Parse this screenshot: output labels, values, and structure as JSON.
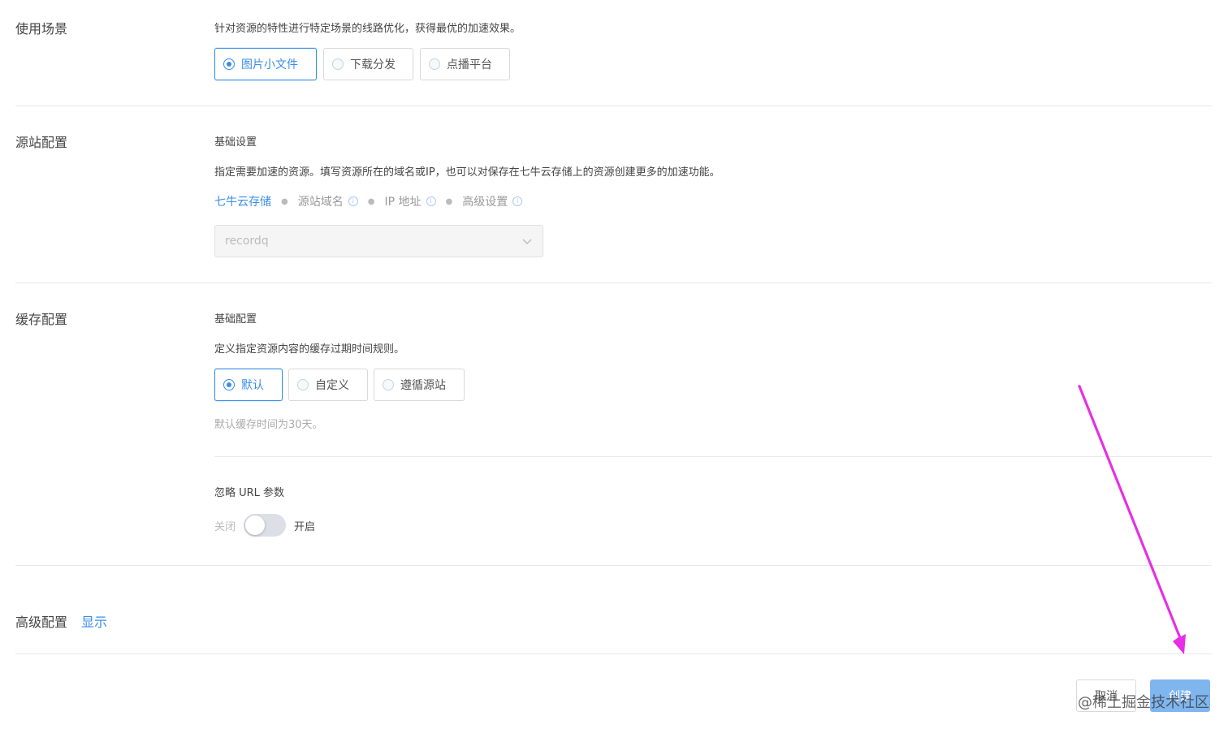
{
  "scenario": {
    "label": "使用场景",
    "description": "针对资源的特性进行特定场景的线路优化，获得最优的加速效果。",
    "options": [
      "图片小文件",
      "下载分发",
      "点播平台"
    ],
    "selected": "图片小文件"
  },
  "origin": {
    "label": "源站配置",
    "subtitle": "基础设置",
    "description": "指定需要加速的资源。填写资源所在的域名或IP，也可以对保存在七牛云存储上的资源创建更多的加速功能。",
    "tabs": [
      "七牛云存储",
      "源站域名",
      "IP 地址",
      "高级设置"
    ],
    "active_tab": "七牛云存储",
    "select_value": "recordq"
  },
  "cache": {
    "label": "缓存配置",
    "subtitle": "基础配置",
    "description": "定义指定资源内容的缓存过期时间规则。",
    "options": [
      "默认",
      "自定义",
      "遵循源站"
    ],
    "selected": "默认",
    "hint": "默认缓存时间为30天。",
    "ignore_url_title": "忽略 URL 参数",
    "switch_off_label": "关闭",
    "switch_on_label": "开启",
    "switch_on": false
  },
  "advanced": {
    "label": "高级配置",
    "toggle_link": "显示"
  },
  "footer": {
    "cancel_label": "取消",
    "create_label": "创建"
  },
  "watermark": "@稀土掘金技术社区",
  "colors": {
    "accent": "#3a8ee6",
    "annotation_arrow": "#e62ee6"
  }
}
